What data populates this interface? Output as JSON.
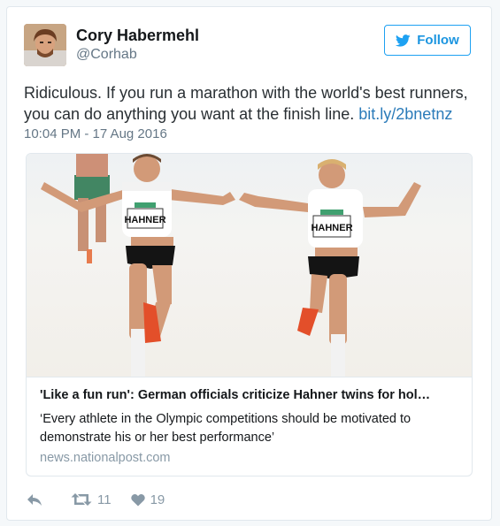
{
  "user": {
    "name": "Cory Habermehl",
    "handle": "@Corhab"
  },
  "follow": {
    "label": "Follow"
  },
  "tweet": {
    "text": "Ridiculous. If you run a marathon with the world's best runners, you can do anything you want at the finish line.",
    "link": "bit.ly/2bnetnz",
    "timestamp": "10:04 PM - 17 Aug 2016"
  },
  "card": {
    "title": "'Like a fun run': German officials criticize Hahner twins for hol…",
    "description": "‘Every athlete in the Olympic competitions should be motivated to demonstrate his or her best performance’",
    "domain": "news.nationalpost.com",
    "bibs": [
      "HAHNER",
      "HAHNER"
    ]
  },
  "actions": {
    "retweets": "11",
    "likes": "19"
  },
  "colors": {
    "accent": "#1da1f2",
    "link": "#2b7bb9",
    "muted": "#657786"
  },
  "icons": {
    "avatar": "avatar",
    "follow": "twitter-bird-icon",
    "reply": "reply-icon",
    "retweet": "retweet-icon",
    "like": "heart-icon"
  }
}
